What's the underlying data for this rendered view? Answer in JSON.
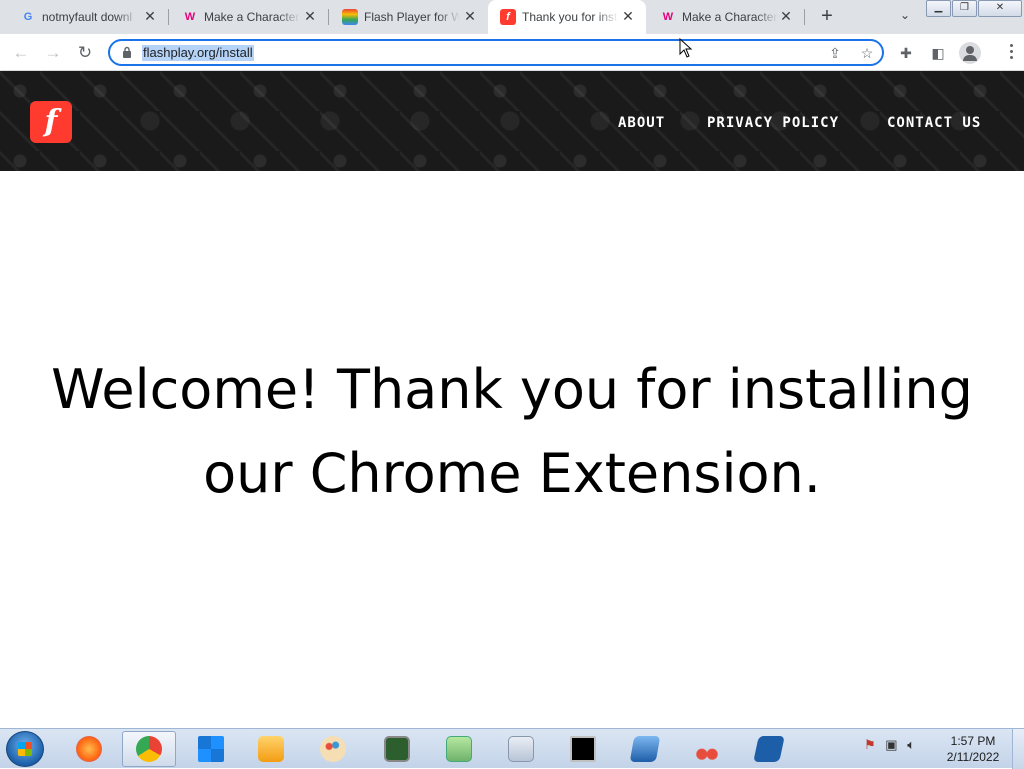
{
  "browser": {
    "tabs": [
      {
        "label": "notmyfault downl",
        "favicon": "google-icon",
        "favicon_color": "#4285f4",
        "active": false
      },
      {
        "label": "Make a Character",
        "favicon": "w-icon",
        "favicon_color": "#e6007e",
        "active": false
      },
      {
        "label": "Flash Player for W",
        "favicon": "rainbow-icon",
        "favicon_color": "#34a853",
        "active": false
      },
      {
        "label": "Thank you for insta",
        "favicon": "flash-icon",
        "favicon_color": "#ff3b30",
        "active": true
      },
      {
        "label": "Make a Character",
        "favicon": "w-icon",
        "favicon_color": "#e6007e",
        "active": false
      }
    ],
    "new_tab_label": "+",
    "address": "flashplay.org/install"
  },
  "site": {
    "logo_letter": "f",
    "nav": [
      "ABOUT",
      "PRIVACY POLICY",
      "CONTACT US"
    ]
  },
  "main": {
    "welcome": "Welcome! Thank you for installing our Chrome Extension."
  },
  "taskbar": {
    "apps": [
      "start-button",
      "firefox-icon",
      "chrome-icon",
      "windows-icon",
      "media-player-icon",
      "paint-icon",
      "task-manager-icon",
      "notepad-icon",
      "calculator-icon",
      "cmd-icon",
      "remote-desktop-icon",
      "snipping-tool-icon",
      "powershell-icon"
    ],
    "time": "1:57 PM",
    "date": "2/11/2022"
  }
}
